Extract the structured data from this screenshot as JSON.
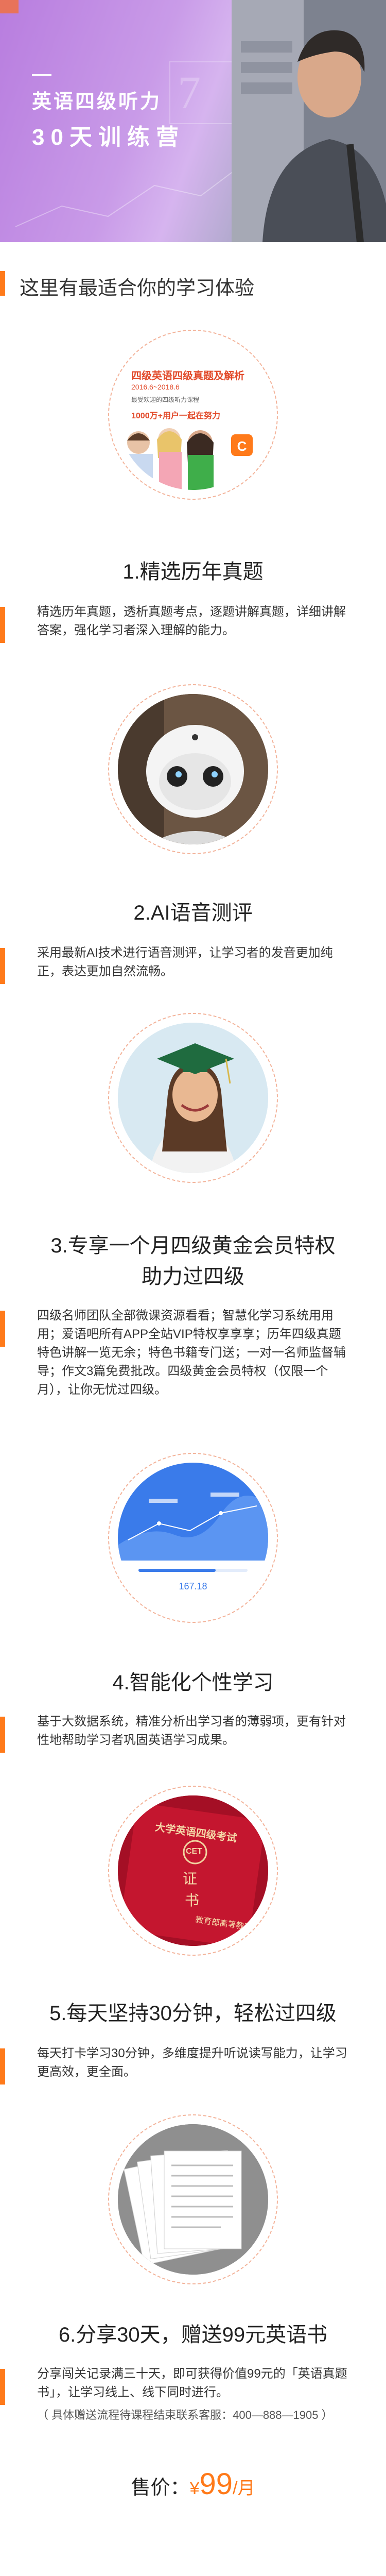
{
  "hero": {
    "title_line1": "英语四级听力",
    "title_line2": "30天训练营"
  },
  "section": {
    "heading": "这里有最适合你的学习体验"
  },
  "features": [
    {
      "title": "1.精选历年真题",
      "desc": "精选历年真题，透析真题考点，逐题讲解真题，详细讲解答案，强化学习者深入理解的能力。",
      "image": {
        "banner_title": "四级英语四级真题及解析",
        "date": "2016.6~2018.6",
        "sub": "最受欢迎的四级听力课程",
        "users": "1000万+用户一起在努力"
      }
    },
    {
      "title": "2.AI语音测评",
      "desc": "采用最新AI技术进行语音测评，让学习者的发音更加纯正，表达更加自然流畅。"
    },
    {
      "title_line1": "3.专享一个月四级黄金会员特权",
      "title_line2": "助力过四级",
      "desc": "四级名师团队全部微课资源看看；智慧化学习系统用用用；爱语吧所有APP全站VIP特权享享享；历年四级真题特色讲解一览无余；特色书籍专门送；一对一名师监督辅导；作文3篇免费批改。四级黄金会员特权（仅限一个月），让你无忧过四级。"
    },
    {
      "title": "4.智能化个性学习",
      "desc": "基于大数据系统，精准分析出学习者的薄弱项，更有针对性地帮助学习者巩固英语学习成果。",
      "image": {
        "value": "167.18"
      }
    },
    {
      "title": "5.每天坚持30分钟，轻松过四级",
      "desc": "每天打卡学习30分钟，多维度提升听说读写能力，让学习更高效，更全面。",
      "image": {
        "header": "大学英语四级考试",
        "logo": "CET",
        "cert1": "证",
        "cert2": "书",
        "issuer": "教育部高等教育司"
      }
    },
    {
      "title": "6.分享30天，赠送99元英语书",
      "desc": "分享闯关记录满三十天，即可获得价值99元的「英语真题书」，让学习线上、线下同时进行。",
      "note": "（ 具体赠送流程待课程结束联系客服：400—888—1905 ）"
    }
  ],
  "price": {
    "label": "售价：",
    "currency": "¥",
    "amount": "99",
    "unit": "/月"
  },
  "colors": {
    "accent": "#ff7a1a",
    "circle_border": "#f3b39a"
  }
}
